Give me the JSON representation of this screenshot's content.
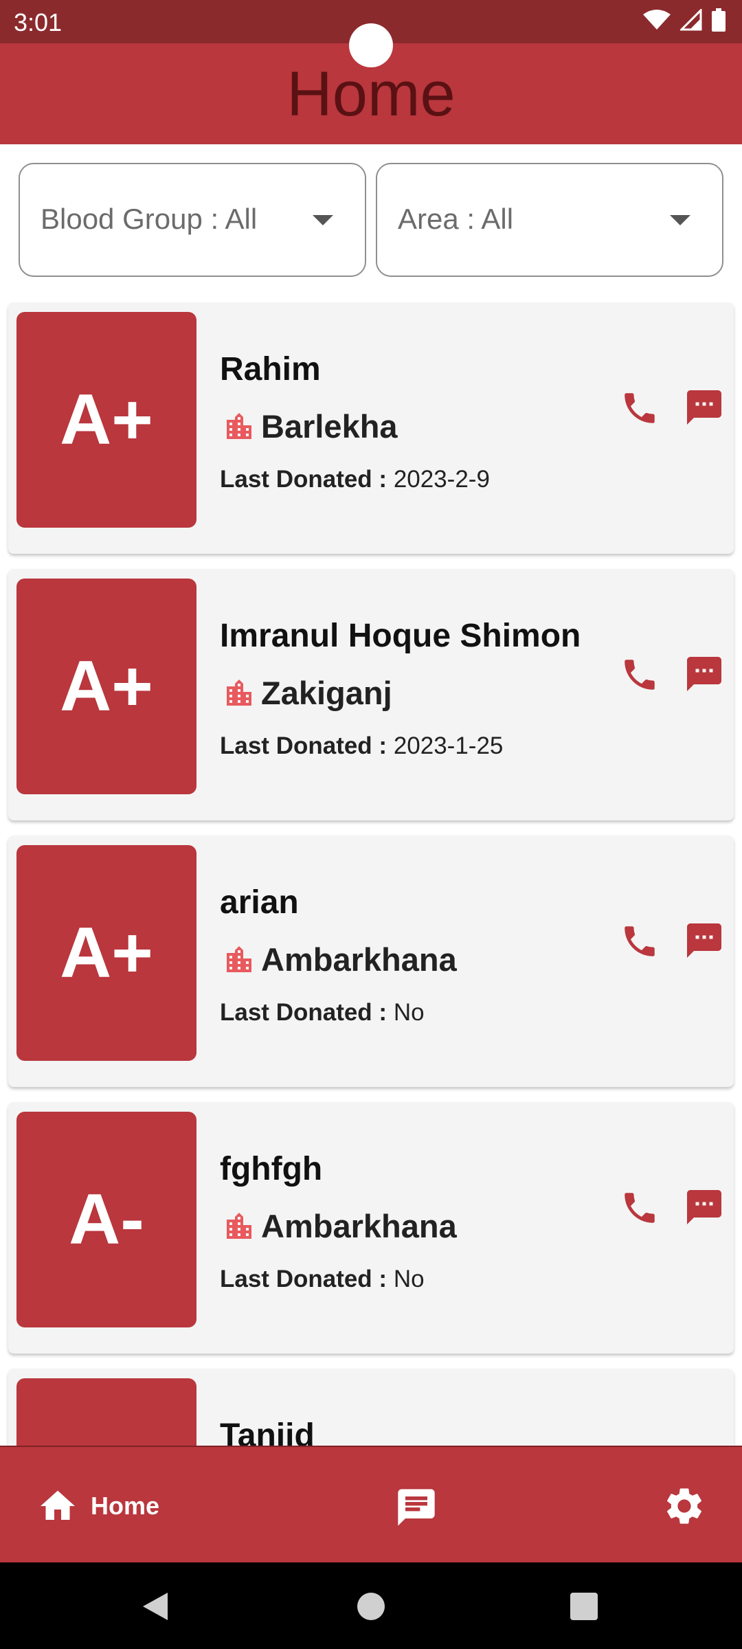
{
  "status_bar": {
    "time": "3:01",
    "icons": [
      "wifi-icon",
      "signal-icon",
      "battery-icon"
    ]
  },
  "app_bar": {
    "title": "Home"
  },
  "filters": {
    "blood_group_label": "Blood Group : All",
    "area_label": "Area : All"
  },
  "donors": [
    {
      "group": "A+",
      "name": "Rahim",
      "area": "Barlekha",
      "last_donated_label": "Last Donated :",
      "last_donated": "2023-2-9"
    },
    {
      "group": "A+",
      "name": "Imranul Hoque Shimon",
      "area": "Zakiganj",
      "last_donated_label": "Last Donated :",
      "last_donated": "2023-1-25"
    },
    {
      "group": "A+",
      "name": "arian",
      "area": "Ambarkhana",
      "last_donated_label": "Last Donated :",
      "last_donated": "No"
    },
    {
      "group": "A-",
      "name": "fghfgh",
      "area": "Ambarkhana",
      "last_donated_label": "Last Donated :",
      "last_donated": "No"
    },
    {
      "group": "",
      "name": "Tanjid",
      "area": "",
      "last_donated_label": "",
      "last_donated": ""
    }
  ],
  "bottom_nav": {
    "home_label": "Home"
  },
  "colors": {
    "primary": "#b9373d",
    "status_bar": "#8b2a2d",
    "title_text": "#5a1113",
    "card_bg": "#f4f4f4",
    "building_icon": "#e85a5e"
  }
}
